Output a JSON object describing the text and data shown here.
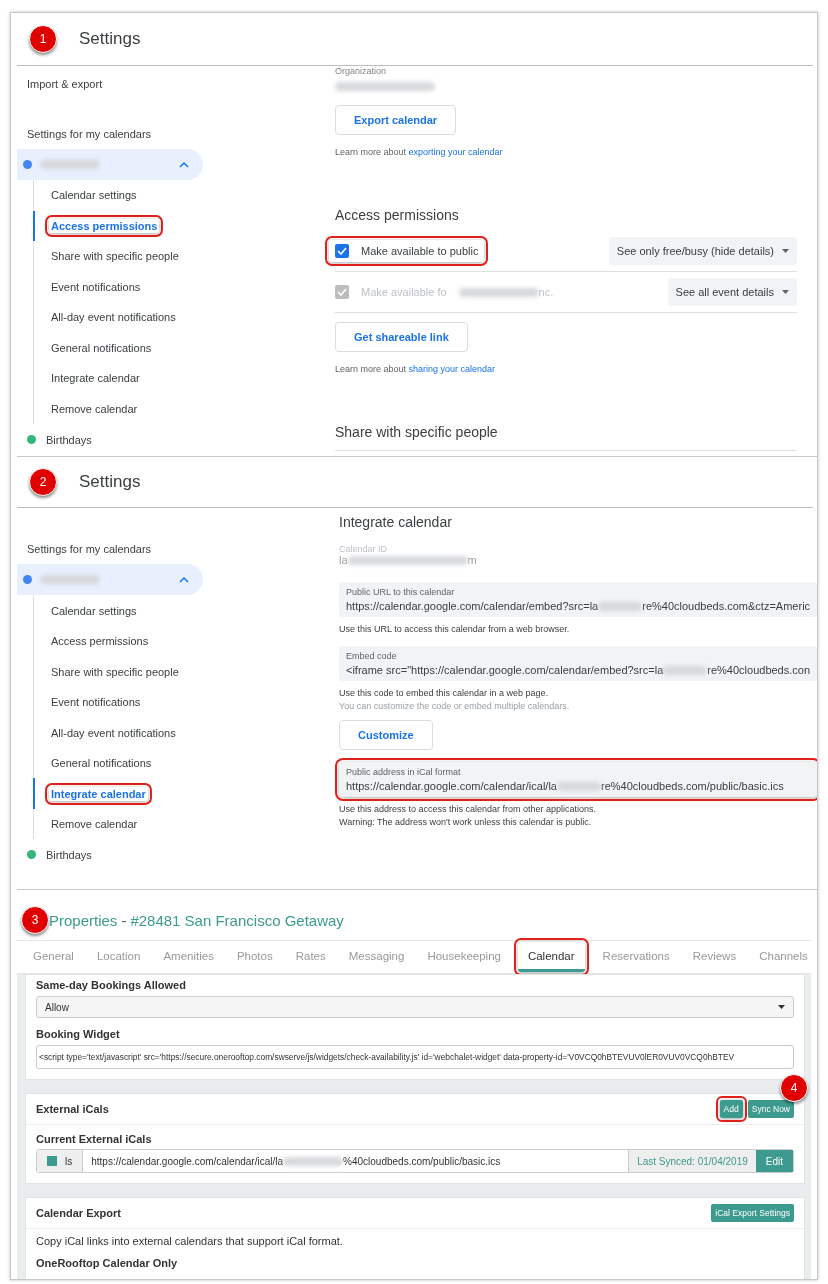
{
  "screen_1": {
    "step": "1",
    "title": "Settings",
    "sidebar": {
      "items": [
        {
          "label": "Import & export"
        }
      ],
      "heading": "Settings for my calendars",
      "calendars": [
        {
          "color": "#4285f4",
          "expanded": true,
          "children": [
            {
              "label": "Calendar settings",
              "selected": false,
              "highlighted": false
            },
            {
              "label": "Access permissions",
              "selected": true,
              "highlighted": true
            },
            {
              "label": "Share with specific people",
              "selected": false,
              "highlighted": false
            },
            {
              "label": "Event notifications",
              "selected": false,
              "highlighted": false
            },
            {
              "label": "All-day event notifications",
              "selected": false,
              "highlighted": false
            },
            {
              "label": "General notifications",
              "selected": false,
              "highlighted": false
            },
            {
              "label": "Integrate calendar",
              "selected": false,
              "highlighted": false
            },
            {
              "label": "Remove calendar",
              "selected": false,
              "highlighted": false
            }
          ]
        },
        {
          "label": "Birthdays",
          "color": "#33b679"
        }
      ]
    },
    "content": {
      "organization_label": "Organization",
      "export_button": "Export calendar",
      "export_note": "Learn more about",
      "export_link": "exporting your calendar",
      "access_heading": "Access permissions",
      "permissions": [
        {
          "label": "Make available to public",
          "checked": true,
          "disabled": false,
          "highlighted": true,
          "dropdown": "See only free/busy (hide details)"
        },
        {
          "label": "Make available fo",
          "label_end": "nc.",
          "checked": true,
          "disabled": true,
          "highlighted": false,
          "dropdown": "See all event details"
        }
      ],
      "link_button": "Get shareable link",
      "share_note": "Learn more about",
      "share_link": "sharing your calendar",
      "next_heading": "Share with specific people"
    }
  },
  "screen_2": {
    "step": "2",
    "title": "Settings",
    "sidebar": {
      "heading": "Settings for my calendars",
      "calendars": [
        {
          "color": "#4285f4",
          "expanded": true,
          "children": [
            {
              "label": "Calendar settings",
              "selected": false,
              "highlighted": false
            },
            {
              "label": "Access permissions",
              "selected": false,
              "highlighted": false
            },
            {
              "label": "Share with specific people",
              "selected": false,
              "highlighted": false
            },
            {
              "label": "Event notifications",
              "selected": false,
              "highlighted": false
            },
            {
              "label": "All-day event notifications",
              "selected": false,
              "highlighted": false
            },
            {
              "label": "General notifications",
              "selected": false,
              "highlighted": false
            },
            {
              "label": "Integrate calendar",
              "selected": true,
              "highlighted": true
            },
            {
              "label": "Remove calendar",
              "selected": false,
              "highlighted": false
            }
          ]
        },
        {
          "label": "Birthdays",
          "color": "#33b679"
        }
      ]
    },
    "content": {
      "heading": "Integrate calendar",
      "calendar_id_label": "Calendar ID",
      "calendar_id_start": "la",
      "calendar_id_end": "m",
      "fields": [
        {
          "label": "Public URL to this calendar",
          "value_start": "https://calendar.google.com/calendar/embed?src=la",
          "value_end": "re%40cloudbeds.com&ctz=Americ",
          "highlighted": false,
          "notes": [
            {
              "text": "Use this URL to access this calendar from a web browser.",
              "muted": false
            }
          ]
        },
        {
          "label": "Embed code",
          "value_start": "<iframe src=\"https://calendar.google.com/calendar/embed?src=la",
          "value_end": "re%40cloudbeds.con",
          "highlighted": false,
          "notes": [
            {
              "text": "Use this code to embed this calendar in a web page.",
              "muted": false
            },
            {
              "text": "You can customize the code or embed multiple calendars.",
              "muted": true
            }
          ],
          "button": "Customize"
        },
        {
          "label": "Public address in iCal format",
          "value_start": "https://calendar.google.com/calendar/ical/la",
          "value_end": "re%40cloudbeds.com/public/basic.ics",
          "highlighted": true,
          "notes": [
            {
              "text": "Use this address to access this calendar from other applications.",
              "muted": false
            },
            {
              "text": "Warning: The address won't work unless this calendar is public.",
              "muted": false
            }
          ]
        }
      ]
    }
  },
  "screen_3": {
    "step": "3",
    "title_link": "Properties",
    "title_separator": "-",
    "title_name": "#28481 San Francisco Getaway",
    "tabs": [
      {
        "label": "General",
        "selected": false,
        "highlighted": false
      },
      {
        "label": "Location",
        "selected": false,
        "highlighted": false
      },
      {
        "label": "Amenities",
        "selected": false,
        "highlighted": false
      },
      {
        "label": "Photos",
        "selected": false,
        "highlighted": false
      },
      {
        "label": "Rates",
        "selected": false,
        "highlighted": false
      },
      {
        "label": "Messaging",
        "selected": false,
        "highlighted": false
      },
      {
        "label": "Housekeeping",
        "selected": false,
        "highlighted": false
      },
      {
        "label": "Calendar",
        "selected": true,
        "highlighted": true
      },
      {
        "label": "Reservations",
        "selected": false,
        "highlighted": false
      },
      {
        "label": "Reviews",
        "selected": false,
        "highlighted": false
      },
      {
        "label": "Channels",
        "selected": false,
        "highlighted": false
      }
    ],
    "booking": {
      "same_day_label": "Same-day Bookings Allowed",
      "same_day_value": "Allow",
      "widget_label": "Booking Widget",
      "widget_value": "<script type='text/javascript' src='https://secure.onerooftop.com/swserve/js/widgets/check-availability.js' id='webchalet-widget' data-property-id='V0VCQ0hBTEVUV0lER0VUV0VCQ0hBTEV"
    },
    "external": {
      "title": "External iCals",
      "step": "4",
      "buttons": [
        {
          "label": "Add",
          "highlighted": true
        },
        {
          "label": "Sync Now",
          "highlighted": false
        }
      ],
      "subheading": "Current External iCals",
      "icals": [
        {
          "color": "#3d9a8e",
          "name": "ls",
          "url_start": "https://calendar.google.com/calendar/ical/la",
          "url_end": "%40cloudbeds.com/public/basic.ics",
          "last_synced": "Last Synced: 01/04/2019",
          "edit": "Edit"
        }
      ]
    },
    "export": {
      "title": "Calendar Export",
      "button": "iCal Export Settings",
      "text": "Copy iCal links into external calendars that support iCal format.",
      "subheading": "OneRooftop Calendar Only"
    }
  }
}
